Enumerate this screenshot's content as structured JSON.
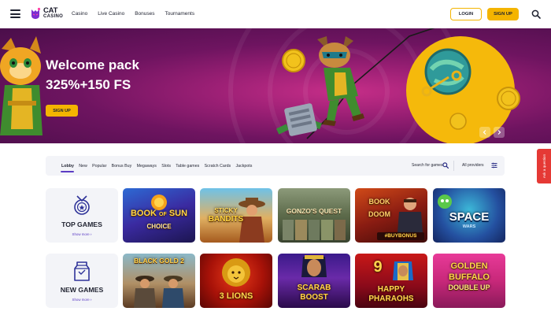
{
  "header": {
    "logo_line1": "CAT",
    "logo_line2": "CASINO",
    "nav": [
      "Casino",
      "Live Casino",
      "Bonuses",
      "Tournaments"
    ],
    "login_label": "LOGIN",
    "signup_label": "SIGN UP",
    "icons": [
      "menu-icon",
      "search-icon"
    ]
  },
  "banner": {
    "title": "Welcome pack",
    "subtitle": "325%+150 FS",
    "button_label": "SIGN UP",
    "colors": {
      "primary": "#9a1f74",
      "accent": "#f5b90b"
    }
  },
  "side_tab": {
    "label": "Ask a question"
  },
  "filters": {
    "categories": [
      "Lobby",
      "New",
      "Popular",
      "Bonus Buy",
      "Megaways",
      "Slots",
      "Table games",
      "Scratch Cards",
      "Jackpots"
    ],
    "active": "Lobby",
    "search_label": "Search for games",
    "providers_label": "All providers"
  },
  "rows": [
    {
      "title": "TOP GAMES",
      "show_more": "Show more",
      "games": [
        {
          "name": "BOOK OF SUN CHOICE",
          "lines": [
            "BOOK",
            "SUN",
            "CHOICE"
          ]
        },
        {
          "name": "STICKY BANDITS",
          "lines": [
            "STICKY",
            "BANDITS"
          ]
        },
        {
          "name": "GONZO'S QUEST",
          "lines": [
            "GONZO'S QUEST"
          ]
        },
        {
          "name": "BOOK OF DOOM",
          "lines": [
            "BOOK",
            "DOOM",
            "#BUYBONUS"
          ]
        },
        {
          "name": "SPACE WARS",
          "lines": [
            "SPACE",
            "WARS"
          ]
        }
      ]
    },
    {
      "title": "NEW GAMES",
      "show_more": "Show more",
      "games": [
        {
          "name": "BLACK GOLD 2",
          "lines": [
            "BLACK GOLD 2"
          ]
        },
        {
          "name": "3 LIONS",
          "lines": [
            "3 LIONS"
          ]
        },
        {
          "name": "SCARAB BOOST",
          "lines": [
            "SCARAB",
            "BOOST"
          ]
        },
        {
          "name": "9 HAPPY PHARAOHS",
          "lines": [
            "9",
            "HAPPY",
            "PHARAOHS"
          ]
        },
        {
          "name": "GOLDEN BUFFALO DOUBLE UP",
          "lines": [
            "GOLDEN",
            "BUFFALO",
            "DOUBLE UP"
          ]
        }
      ]
    }
  ]
}
